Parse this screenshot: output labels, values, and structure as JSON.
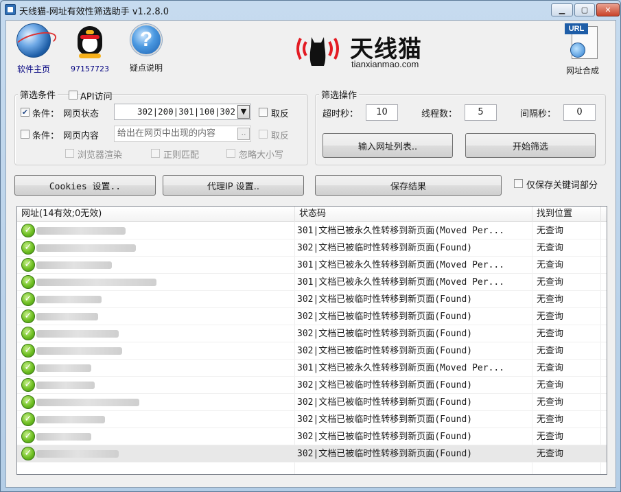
{
  "window": {
    "title": "天线猫-网址有效性筛选助手 v1.2.8.0",
    "min_label": "▁",
    "max_label": "▢",
    "close_label": "✕"
  },
  "toolbar": {
    "home_label": "软件主页",
    "qq_label": "97157723",
    "help_label": "疑点说明",
    "help_glyph": "?",
    "url_merge_label": "网址合成",
    "url_tag": "URL"
  },
  "logo": {
    "brand": "天线猫",
    "domain": "tianxianmao.com"
  },
  "filter": {
    "group_label": "筛选条件",
    "api_label": "API访问",
    "cond1_label": "条件：",
    "cond1_field": "网页状态",
    "cond1_value": "302|200|301|100|302",
    "cond1_invert": "取反",
    "cond2_label": "条件：",
    "cond2_field": "网页内容",
    "cond2_placeholder": "给出在网页中出现的内容",
    "cond2_more": "..",
    "cond2_invert": "取反",
    "opt_browser": "浏览器渲染",
    "opt_regex": "正则匹配",
    "opt_ignore_case": "忽略大小写",
    "cond1_checked": true
  },
  "operation": {
    "group_label": "筛选操作",
    "timeout_label": "超时秒：",
    "timeout_value": "10",
    "threads_label": "线程数：",
    "threads_value": "5",
    "interval_label": "间隔秒：",
    "interval_value": "0",
    "input_list_button": "输入网址列表..",
    "start_button": "开始筛选"
  },
  "actions": {
    "cookies_button": "Cookies 设置..",
    "proxy_button": "代理IP 设置..",
    "save_button": "保存结果",
    "keyword_only_label": "仅保存关键词部分"
  },
  "table": {
    "headers": [
      "网址(14有效;0无效)",
      "状态码",
      "找到位置"
    ],
    "rows": [
      {
        "url": "",
        "status": "301|文档已被永久性转移到新页面(Moved Per...",
        "pos": "无查询"
      },
      {
        "url": "",
        "status": "302|文档已被临时性转移到新页面(Found)",
        "pos": "无查询"
      },
      {
        "url": "",
        "status": "301|文档已被永久性转移到新页面(Moved Per...",
        "pos": "无查询"
      },
      {
        "url": "",
        "status": "301|文档已被永久性转移到新页面(Moved Per...",
        "pos": "无查询"
      },
      {
        "url": "",
        "status": "302|文档已被临时性转移到新页面(Found)",
        "pos": "无查询"
      },
      {
        "url": "",
        "status": "302|文档已被临时性转移到新页面(Found)",
        "pos": "无查询"
      },
      {
        "url": "",
        "status": "302|文档已被临时性转移到新页面(Found)",
        "pos": "无查询"
      },
      {
        "url": "",
        "status": "302|文档已被临时性转移到新页面(Found)",
        "pos": "无查询"
      },
      {
        "url": "",
        "status": "301|文档已被永久性转移到新页面(Moved Per...",
        "pos": "无查询"
      },
      {
        "url": "",
        "status": "302|文档已被临时性转移到新页面(Found)",
        "pos": "无查询"
      },
      {
        "url": "",
        "status": "302|文档已被临时性转移到新页面(Found)",
        "pos": "无查询"
      },
      {
        "url": "",
        "status": "302|文档已被临时性转移到新页面(Found)",
        "pos": "无查询"
      },
      {
        "url": "",
        "status": "302|文档已被临时性转移到新页面(Found)",
        "pos": "无查询"
      },
      {
        "url": "",
        "status": "302|文档已被临时性转移到新页面(Found)",
        "pos": "无查询"
      }
    ]
  },
  "colors": {
    "brand_red": "#e31b23",
    "ok_green": "#6fbf22",
    "selected_row": "#e8e8e8"
  }
}
